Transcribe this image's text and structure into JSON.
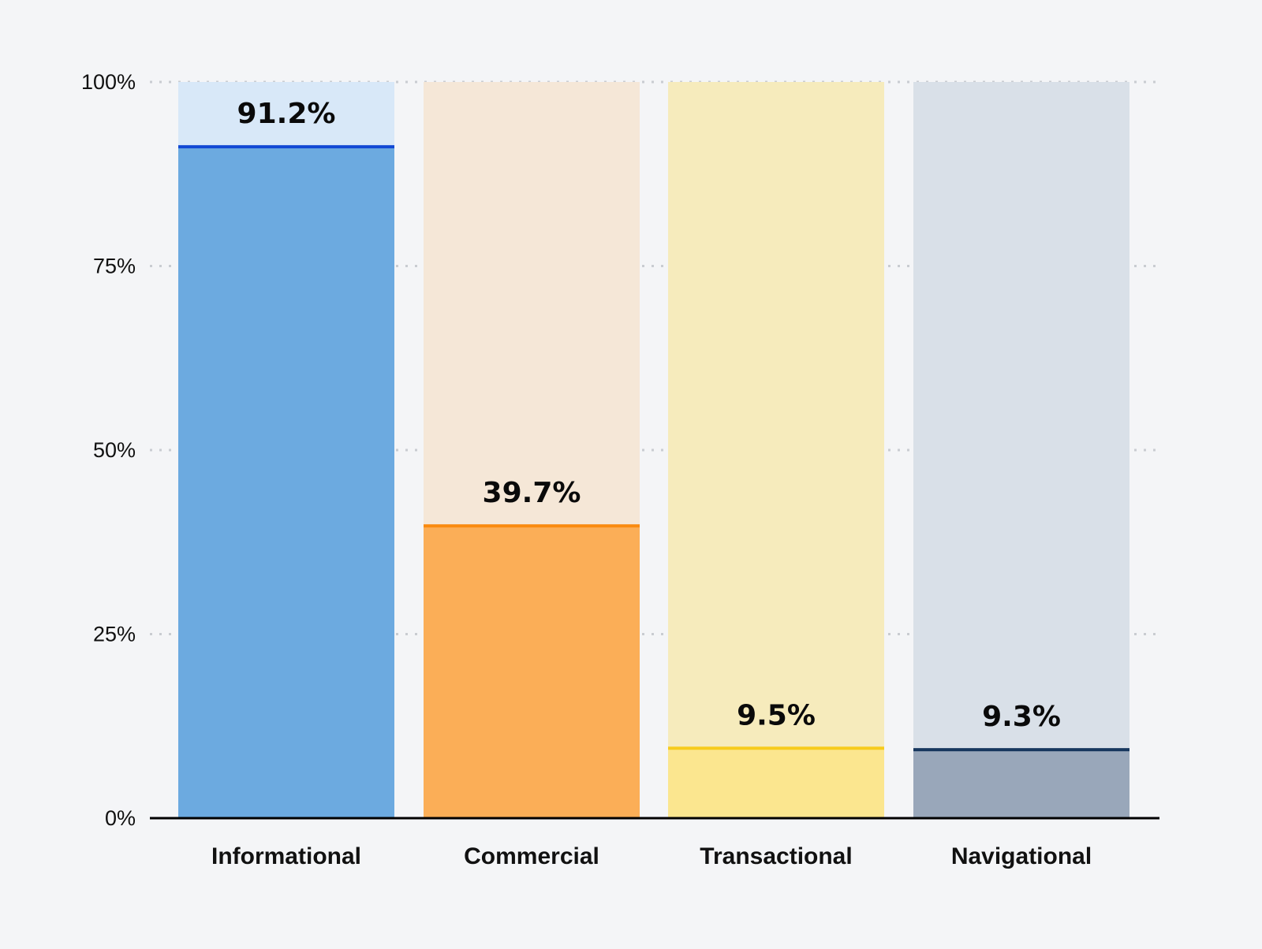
{
  "chart_data": {
    "type": "bar",
    "title": "",
    "xlabel": "",
    "ylabel": "",
    "categories": [
      "Informational",
      "Commercial",
      "Transactional",
      "Navigational"
    ],
    "values": [
      91.2,
      39.7,
      9.5,
      9.3
    ],
    "value_labels": [
      "91.2%",
      "39.7%",
      "9.5%",
      "9.3%"
    ],
    "ylim": [
      0,
      100
    ],
    "yticks": [
      0,
      25,
      50,
      75,
      100
    ],
    "ytick_labels": [
      "0%",
      "25%",
      "50%",
      "75%",
      "100%"
    ],
    "grid": "horizontal dotted",
    "legend": "none",
    "colors": {
      "fill": [
        "#6caae0",
        "#fbae57",
        "#fbe68f",
        "#99a7ba"
      ],
      "background": [
        "#d8e8f8",
        "#f5e7d7",
        "#f6ebbc",
        "#d9e0e8"
      ],
      "top_line": [
        "#1048d4",
        "#fa8a0f",
        "#f7cb1c",
        "#17375e"
      ]
    }
  }
}
